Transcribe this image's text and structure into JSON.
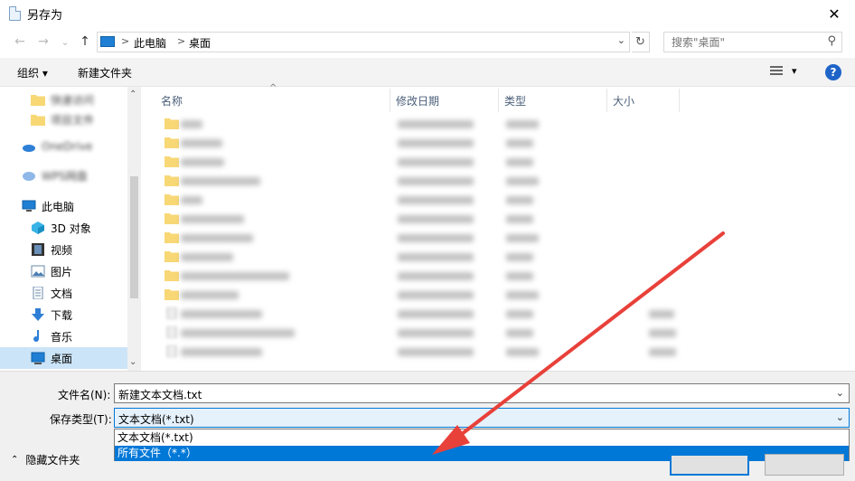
{
  "window": {
    "title": "另存为",
    "close": "✕"
  },
  "nav": {
    "back": "←",
    "forward": "→",
    "recent": "⌄",
    "up": "↑"
  },
  "address": {
    "segments": [
      "此电脑",
      "桌面"
    ],
    "sep": ">",
    "dropdown": "⌄",
    "refresh": "↻"
  },
  "search": {
    "placeholder": "搜索\"桌面\"",
    "icon": "⚲"
  },
  "toolbar": {
    "organize": "组织 ▾",
    "new_folder": "新建文件夹",
    "view_dd": "▾",
    "help": "?"
  },
  "sidebar": {
    "blurred": [
      "快速访问",
      "项目文件",
      "OneDrive",
      "WPS网盘"
    ],
    "items": [
      {
        "label": "此电脑",
        "icon": "pc"
      },
      {
        "label": "3D 对象",
        "icon": "3d"
      },
      {
        "label": "视频",
        "icon": "video"
      },
      {
        "label": "图片",
        "icon": "pictures"
      },
      {
        "label": "文档",
        "icon": "documents"
      },
      {
        "label": "下载",
        "icon": "downloads"
      },
      {
        "label": "音乐",
        "icon": "music"
      },
      {
        "label": "桌面",
        "icon": "desktop"
      }
    ],
    "scroll_up": "⌃",
    "scroll_down": "⌄"
  },
  "columns": {
    "name": "名称",
    "modified": "修改日期",
    "type": "类型",
    "size": "大小",
    "sort_indicator": "^"
  },
  "files": {
    "folder_rows": 10,
    "file_rows": 3
  },
  "save": {
    "filename_label": "文件名(N):",
    "filename_value": "新建文本文档.txt",
    "type_label": "保存类型(T):",
    "type_value": "文本文档(*.txt)",
    "options": [
      "文本文档(*.txt)",
      "所有文件（*.*）"
    ],
    "hide_folders": "隐藏文件夹",
    "hide_chevron": "⌃"
  },
  "colors": {
    "accent": "#0078d7",
    "arrow": "#e8413a",
    "folder": "#f8d775"
  }
}
